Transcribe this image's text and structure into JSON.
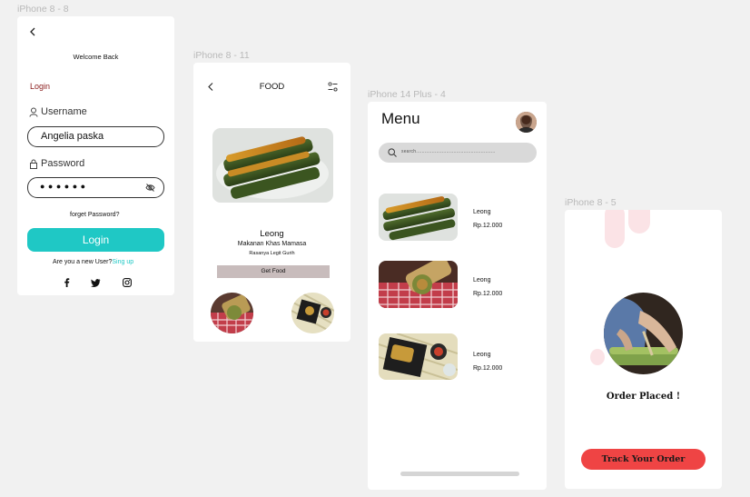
{
  "frames": {
    "login": "iPhone 8 - 8",
    "food": "iPhone 8 - 11",
    "menu": "iPhone 14 Plus - 4",
    "order": "iPhone 8 - 5"
  },
  "login": {
    "title": "Welcome Back",
    "section": "Login",
    "username_label": "Username",
    "username_value": "Angelia paska",
    "password_label": "Password",
    "password_mask": "●  ●  ●  ●  ●  ●",
    "forgot": "forget Password?",
    "login_button": "Login",
    "new_user": "Are you a new User?",
    "signup": "Sing up",
    "accent": "#1fc8c5",
    "section_color": "#8a1c1c"
  },
  "food": {
    "title": "FOOD",
    "name": "Leong",
    "subtitle": "Makanan Khas Mamasa",
    "tagline": "Rasanya Legit Gurih",
    "button": "Get Food",
    "button_color": "#c8bcbc"
  },
  "menu": {
    "title": "Menu",
    "search_placeholder": "search.......................................................",
    "items": [
      {
        "name": "Leong",
        "price": "Rp.12.000"
      },
      {
        "name": "Leong",
        "price": "Rp.12.000"
      },
      {
        "name": "Leong",
        "price": "Rp.12.000"
      }
    ]
  },
  "order": {
    "status": "Order Placed !",
    "button": "Track Your Order",
    "button_color": "#ef4444",
    "blob_color": "#fbe3e6"
  },
  "icons": [
    "back-arrow-icon",
    "user-icon",
    "lock-icon",
    "eye-off-icon",
    "facebook-icon",
    "twitter-icon",
    "instagram-icon",
    "filter-icon",
    "search-icon",
    "avatar"
  ]
}
